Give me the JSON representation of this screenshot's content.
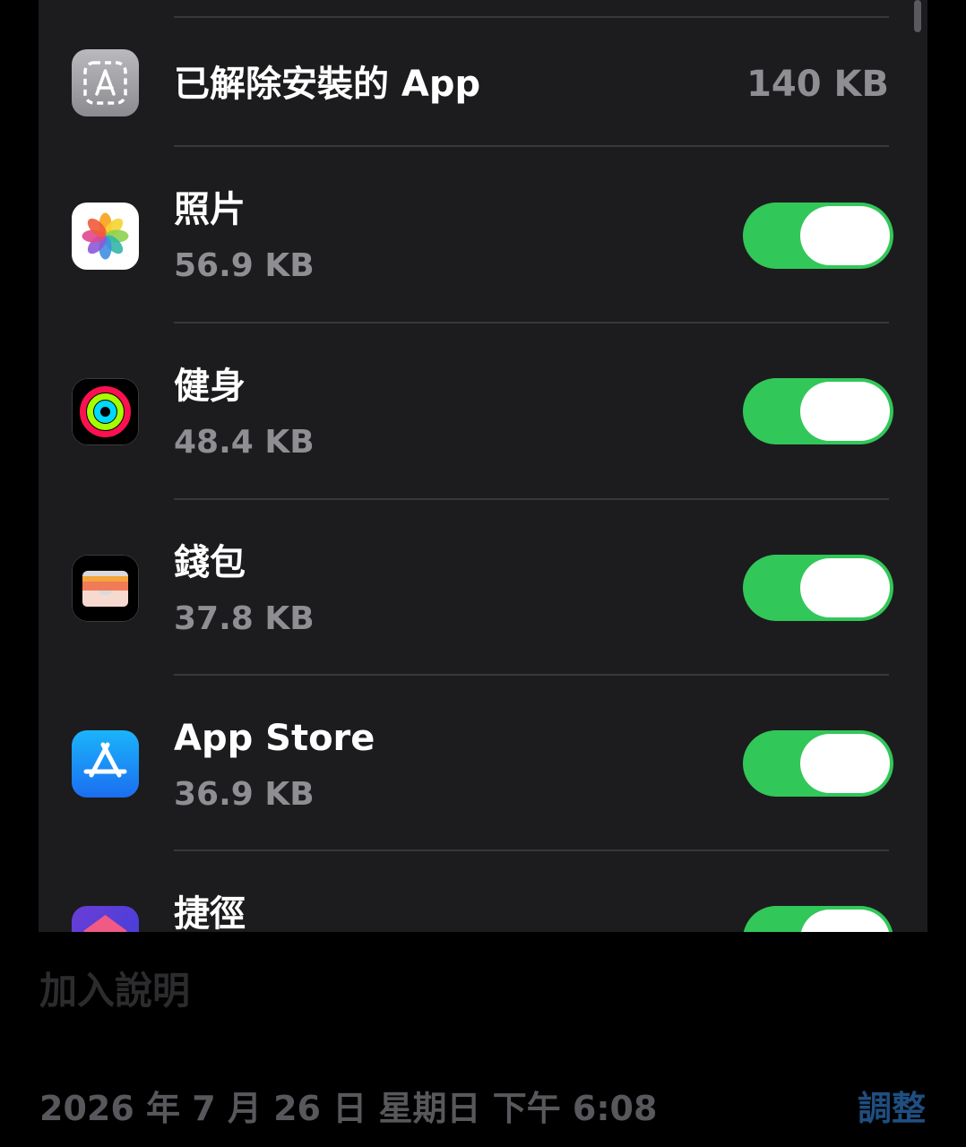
{
  "colors": {
    "panel": "#1c1c1e",
    "toggle_on": "#32c759",
    "secondary_text": "#8e8e93",
    "accent": "#1f4e80"
  },
  "offloaded": {
    "title": "已解除安裝的 App",
    "size": "140 KB",
    "icon": "offloaded-app-icon"
  },
  "apps": [
    {
      "title": "照片",
      "size": "56.9 KB",
      "icon": "photos-icon",
      "enabled": true
    },
    {
      "title": "健身",
      "size": "48.4 KB",
      "icon": "fitness-icon",
      "enabled": true
    },
    {
      "title": "錢包",
      "size": "37.8 KB",
      "icon": "wallet-icon",
      "enabled": true
    },
    {
      "title": "App Store",
      "size": "36.9 KB",
      "icon": "app-store-icon",
      "enabled": true
    },
    {
      "title": "捷徑",
      "icon": "shortcuts-icon",
      "enabled": true
    }
  ],
  "footer": {
    "caption_placeholder": "加入說明",
    "datetime": "2026 年 7 月 26 日 星期日 下午 6:08",
    "adjust_label": "調整"
  }
}
